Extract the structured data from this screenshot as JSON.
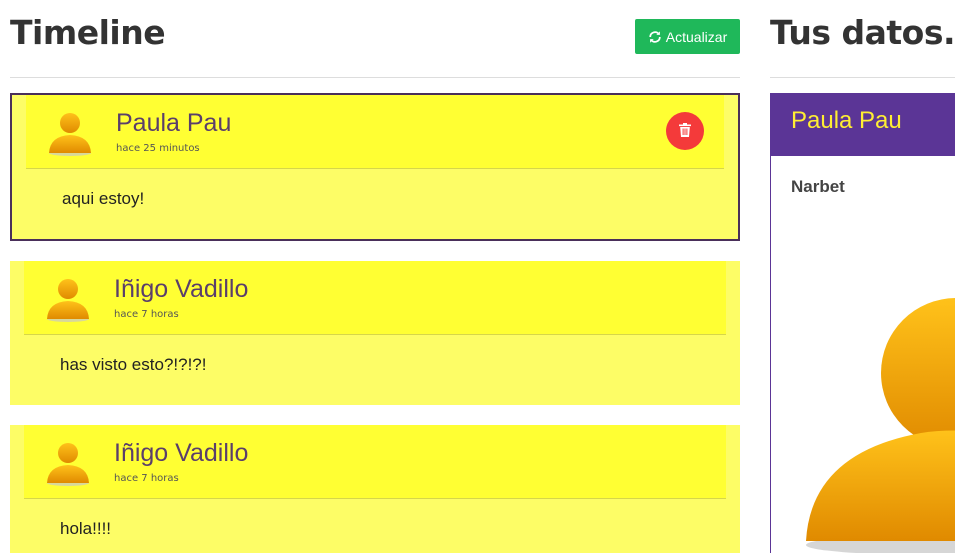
{
  "timeline": {
    "title": "Timeline",
    "refresh_label": "Actualizar",
    "refresh_icon": "refresh-icon",
    "posts": [
      {
        "author": "Paula Pau",
        "time": "hace 25 minutos",
        "text": "aqui estoy!",
        "selected": true,
        "deletable": true
      },
      {
        "author": "Iñigo Vadillo",
        "time": "hace 7 horas",
        "text": "has visto esto?!?!?!",
        "selected": false,
        "deletable": false
      },
      {
        "author": "Iñigo Vadillo",
        "time": "hace 7 horas",
        "text": "hola!!!!",
        "selected": false,
        "deletable": false
      }
    ]
  },
  "profile": {
    "title": "Tus datos...",
    "name": "Paula Pau",
    "nick": "Narbet"
  },
  "colors": {
    "accent_green": "#1fb85a",
    "post_bg": "#fdfd66",
    "post_head_bg": "#ffff33",
    "profile_purple": "#5b3596",
    "profile_name_yellow": "#ffee33",
    "delete_red": "#f43a3a"
  }
}
